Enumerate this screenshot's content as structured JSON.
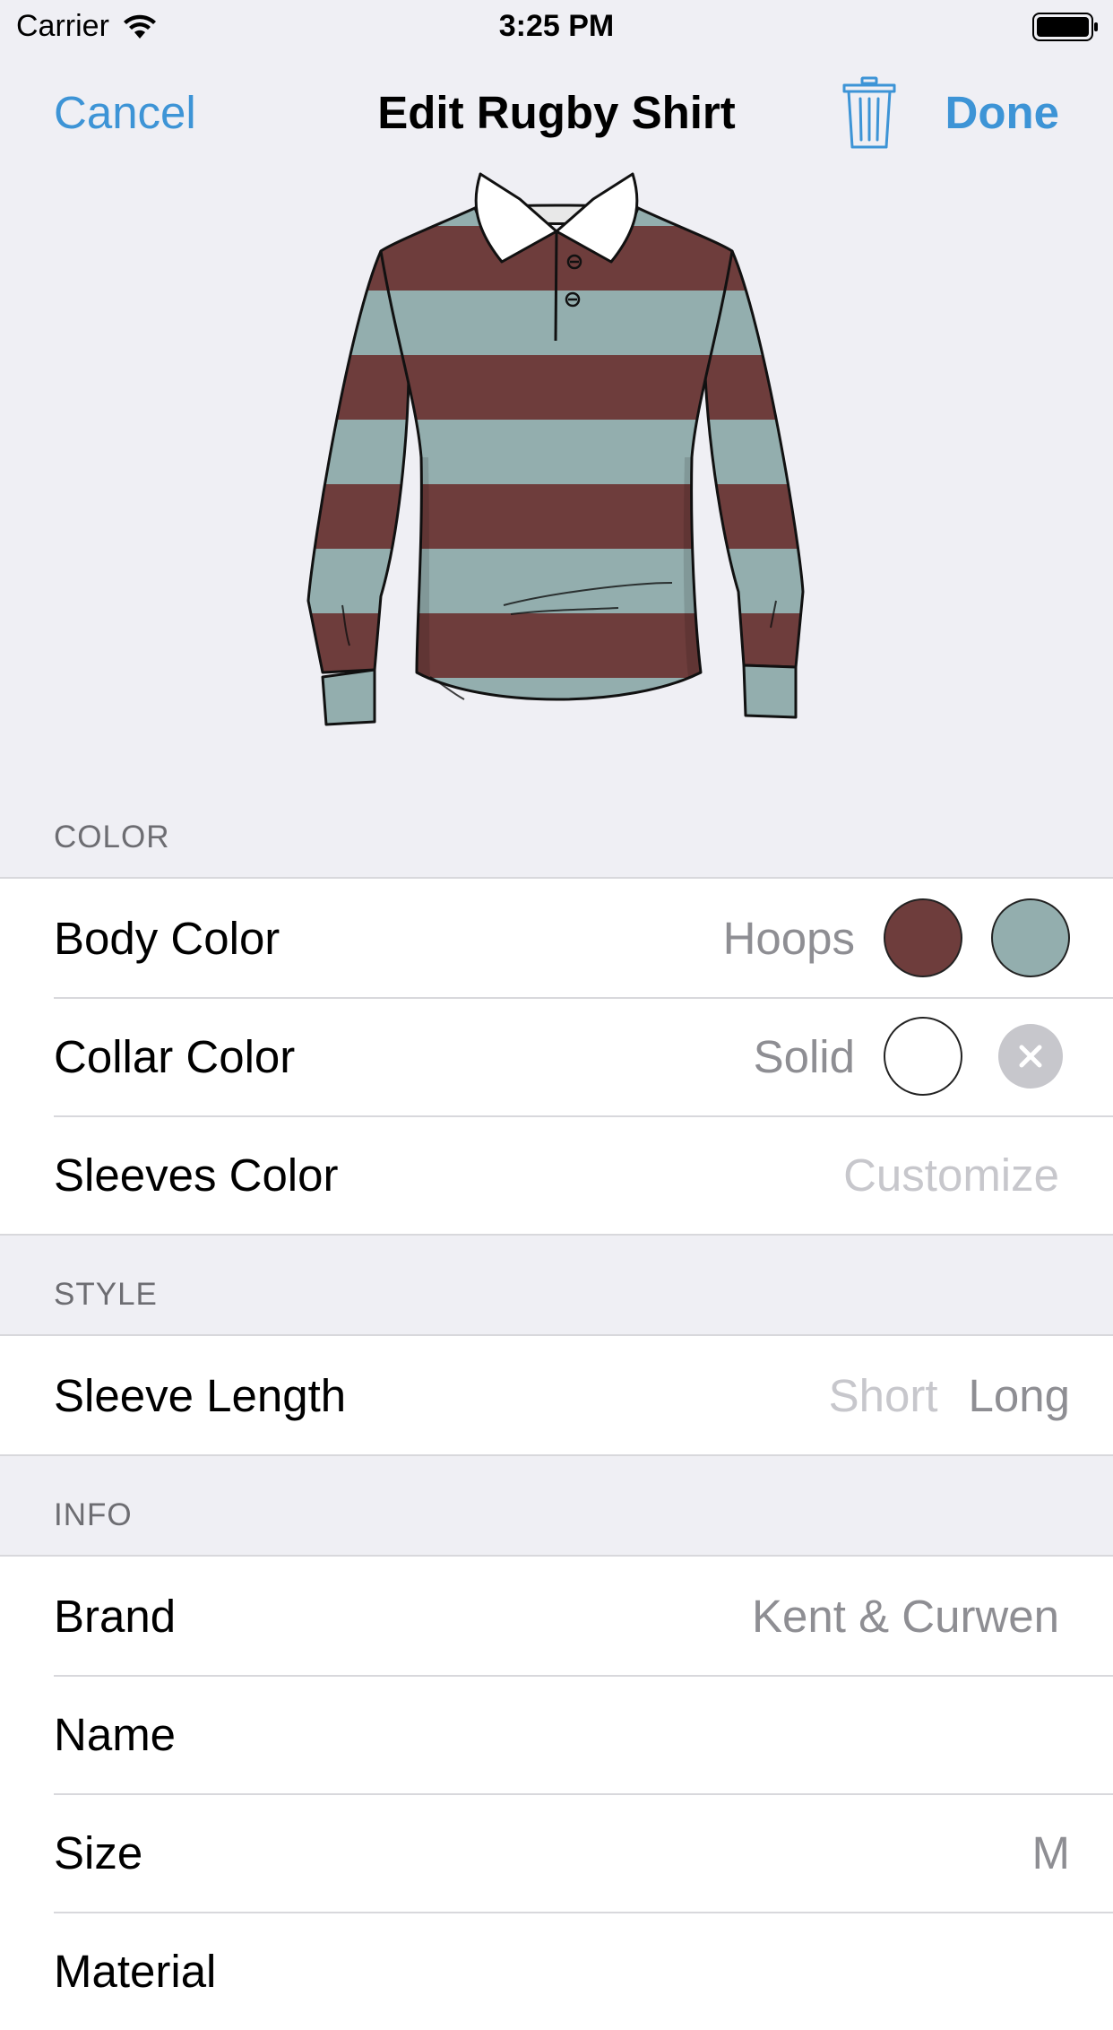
{
  "status_bar": {
    "carrier": "Carrier",
    "time": "3:25 PM"
  },
  "nav": {
    "cancel_label": "Cancel",
    "title": "Edit Rugby Shirt",
    "done_label": "Done",
    "trash_icon": "trash-icon",
    "accent_color": "#3d94d6"
  },
  "shirt": {
    "pattern": "hoops",
    "primary_color": "#6e3d3c",
    "secondary_color": "#93aeae",
    "collar_color": "#ffffff"
  },
  "sections": {
    "color": {
      "header": "COLOR",
      "rows": [
        {
          "label": "Body Color",
          "value": "Hoops",
          "swatches": [
            "#6e3d3c",
            "#93aeae"
          ]
        },
        {
          "label": "Collar Color",
          "value": "Solid",
          "swatches": [
            "#ffffff"
          ],
          "clear_icon": "clear-icon"
        },
        {
          "label": "Sleeves Color",
          "value": "Customize"
        }
      ]
    },
    "style": {
      "header": "STYLE",
      "rows": [
        {
          "label": "Sleeve Length",
          "options": [
            "Short",
            "Long"
          ],
          "selected": "Long"
        }
      ]
    },
    "info": {
      "header": "INFO",
      "rows": [
        {
          "label": "Brand",
          "value": "Kent & Curwen"
        },
        {
          "label": "Name",
          "value": ""
        },
        {
          "label": "Size",
          "value": "M"
        },
        {
          "label": "Material",
          "value": ""
        }
      ]
    }
  }
}
